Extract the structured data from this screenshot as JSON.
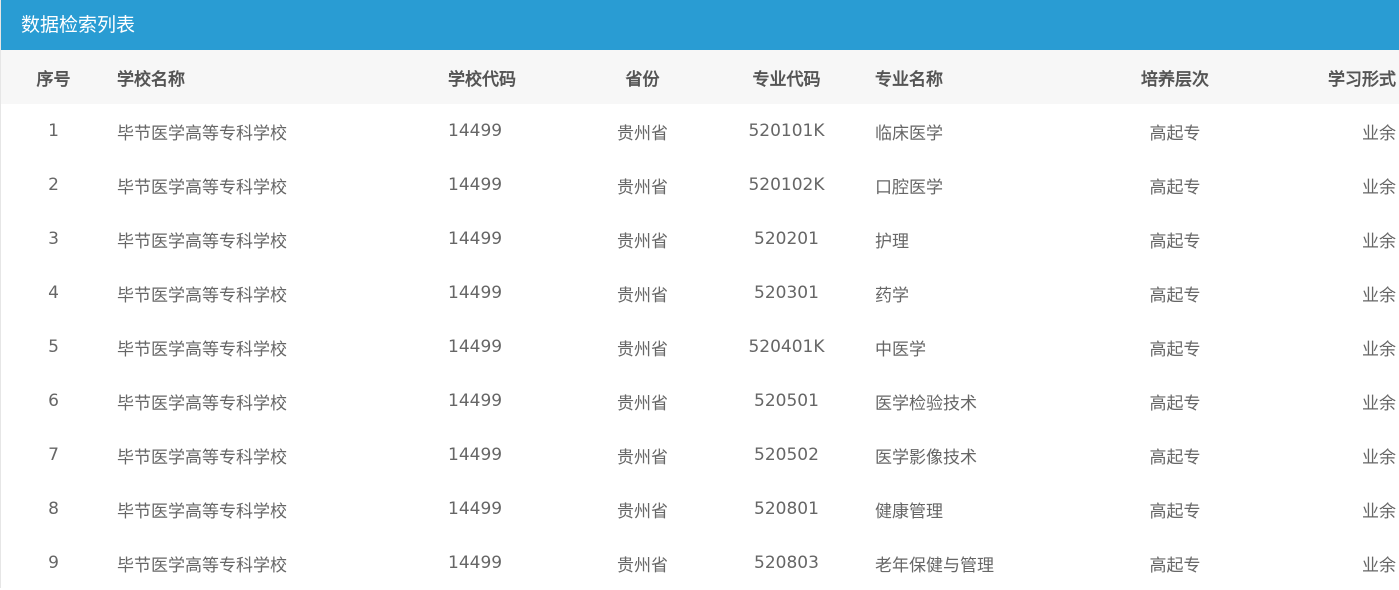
{
  "panel": {
    "title": "数据检索列表"
  },
  "table": {
    "headers": {
      "index": "序号",
      "school_name": "学校名称",
      "school_code": "学校代码",
      "province": "省份",
      "major_code": "专业代码",
      "major_name": "专业名称",
      "level": "培养层次",
      "study_mode": "学习形式"
    },
    "rows": [
      {
        "index": "1",
        "school_name": "毕节医学高等专科学校",
        "school_code": "14499",
        "province": "贵州省",
        "major_code": "520101K",
        "major_name": "临床医学",
        "level": "高起专",
        "study_mode": "业余"
      },
      {
        "index": "2",
        "school_name": "毕节医学高等专科学校",
        "school_code": "14499",
        "province": "贵州省",
        "major_code": "520102K",
        "major_name": "口腔医学",
        "level": "高起专",
        "study_mode": "业余"
      },
      {
        "index": "3",
        "school_name": "毕节医学高等专科学校",
        "school_code": "14499",
        "province": "贵州省",
        "major_code": "520201",
        "major_name": "护理",
        "level": "高起专",
        "study_mode": "业余"
      },
      {
        "index": "4",
        "school_name": "毕节医学高等专科学校",
        "school_code": "14499",
        "province": "贵州省",
        "major_code": "520301",
        "major_name": "药学",
        "level": "高起专",
        "study_mode": "业余"
      },
      {
        "index": "5",
        "school_name": "毕节医学高等专科学校",
        "school_code": "14499",
        "province": "贵州省",
        "major_code": "520401K",
        "major_name": "中医学",
        "level": "高起专",
        "study_mode": "业余"
      },
      {
        "index": "6",
        "school_name": "毕节医学高等专科学校",
        "school_code": "14499",
        "province": "贵州省",
        "major_code": "520501",
        "major_name": "医学检验技术",
        "level": "高起专",
        "study_mode": "业余"
      },
      {
        "index": "7",
        "school_name": "毕节医学高等专科学校",
        "school_code": "14499",
        "province": "贵州省",
        "major_code": "520502",
        "major_name": "医学影像技术",
        "level": "高起专",
        "study_mode": "业余"
      },
      {
        "index": "8",
        "school_name": "毕节医学高等专科学校",
        "school_code": "14499",
        "province": "贵州省",
        "major_code": "520801",
        "major_name": "健康管理",
        "level": "高起专",
        "study_mode": "业余"
      },
      {
        "index": "9",
        "school_name": "毕节医学高等专科学校",
        "school_code": "14499",
        "province": "贵州省",
        "major_code": "520803",
        "major_name": "老年保健与管理",
        "level": "高起专",
        "study_mode": "业余"
      }
    ]
  },
  "colors": {
    "title_bar": "#299cd3",
    "header_bg": "#f7f7f7",
    "header_text": "#555555",
    "cell_text": "#666666"
  }
}
